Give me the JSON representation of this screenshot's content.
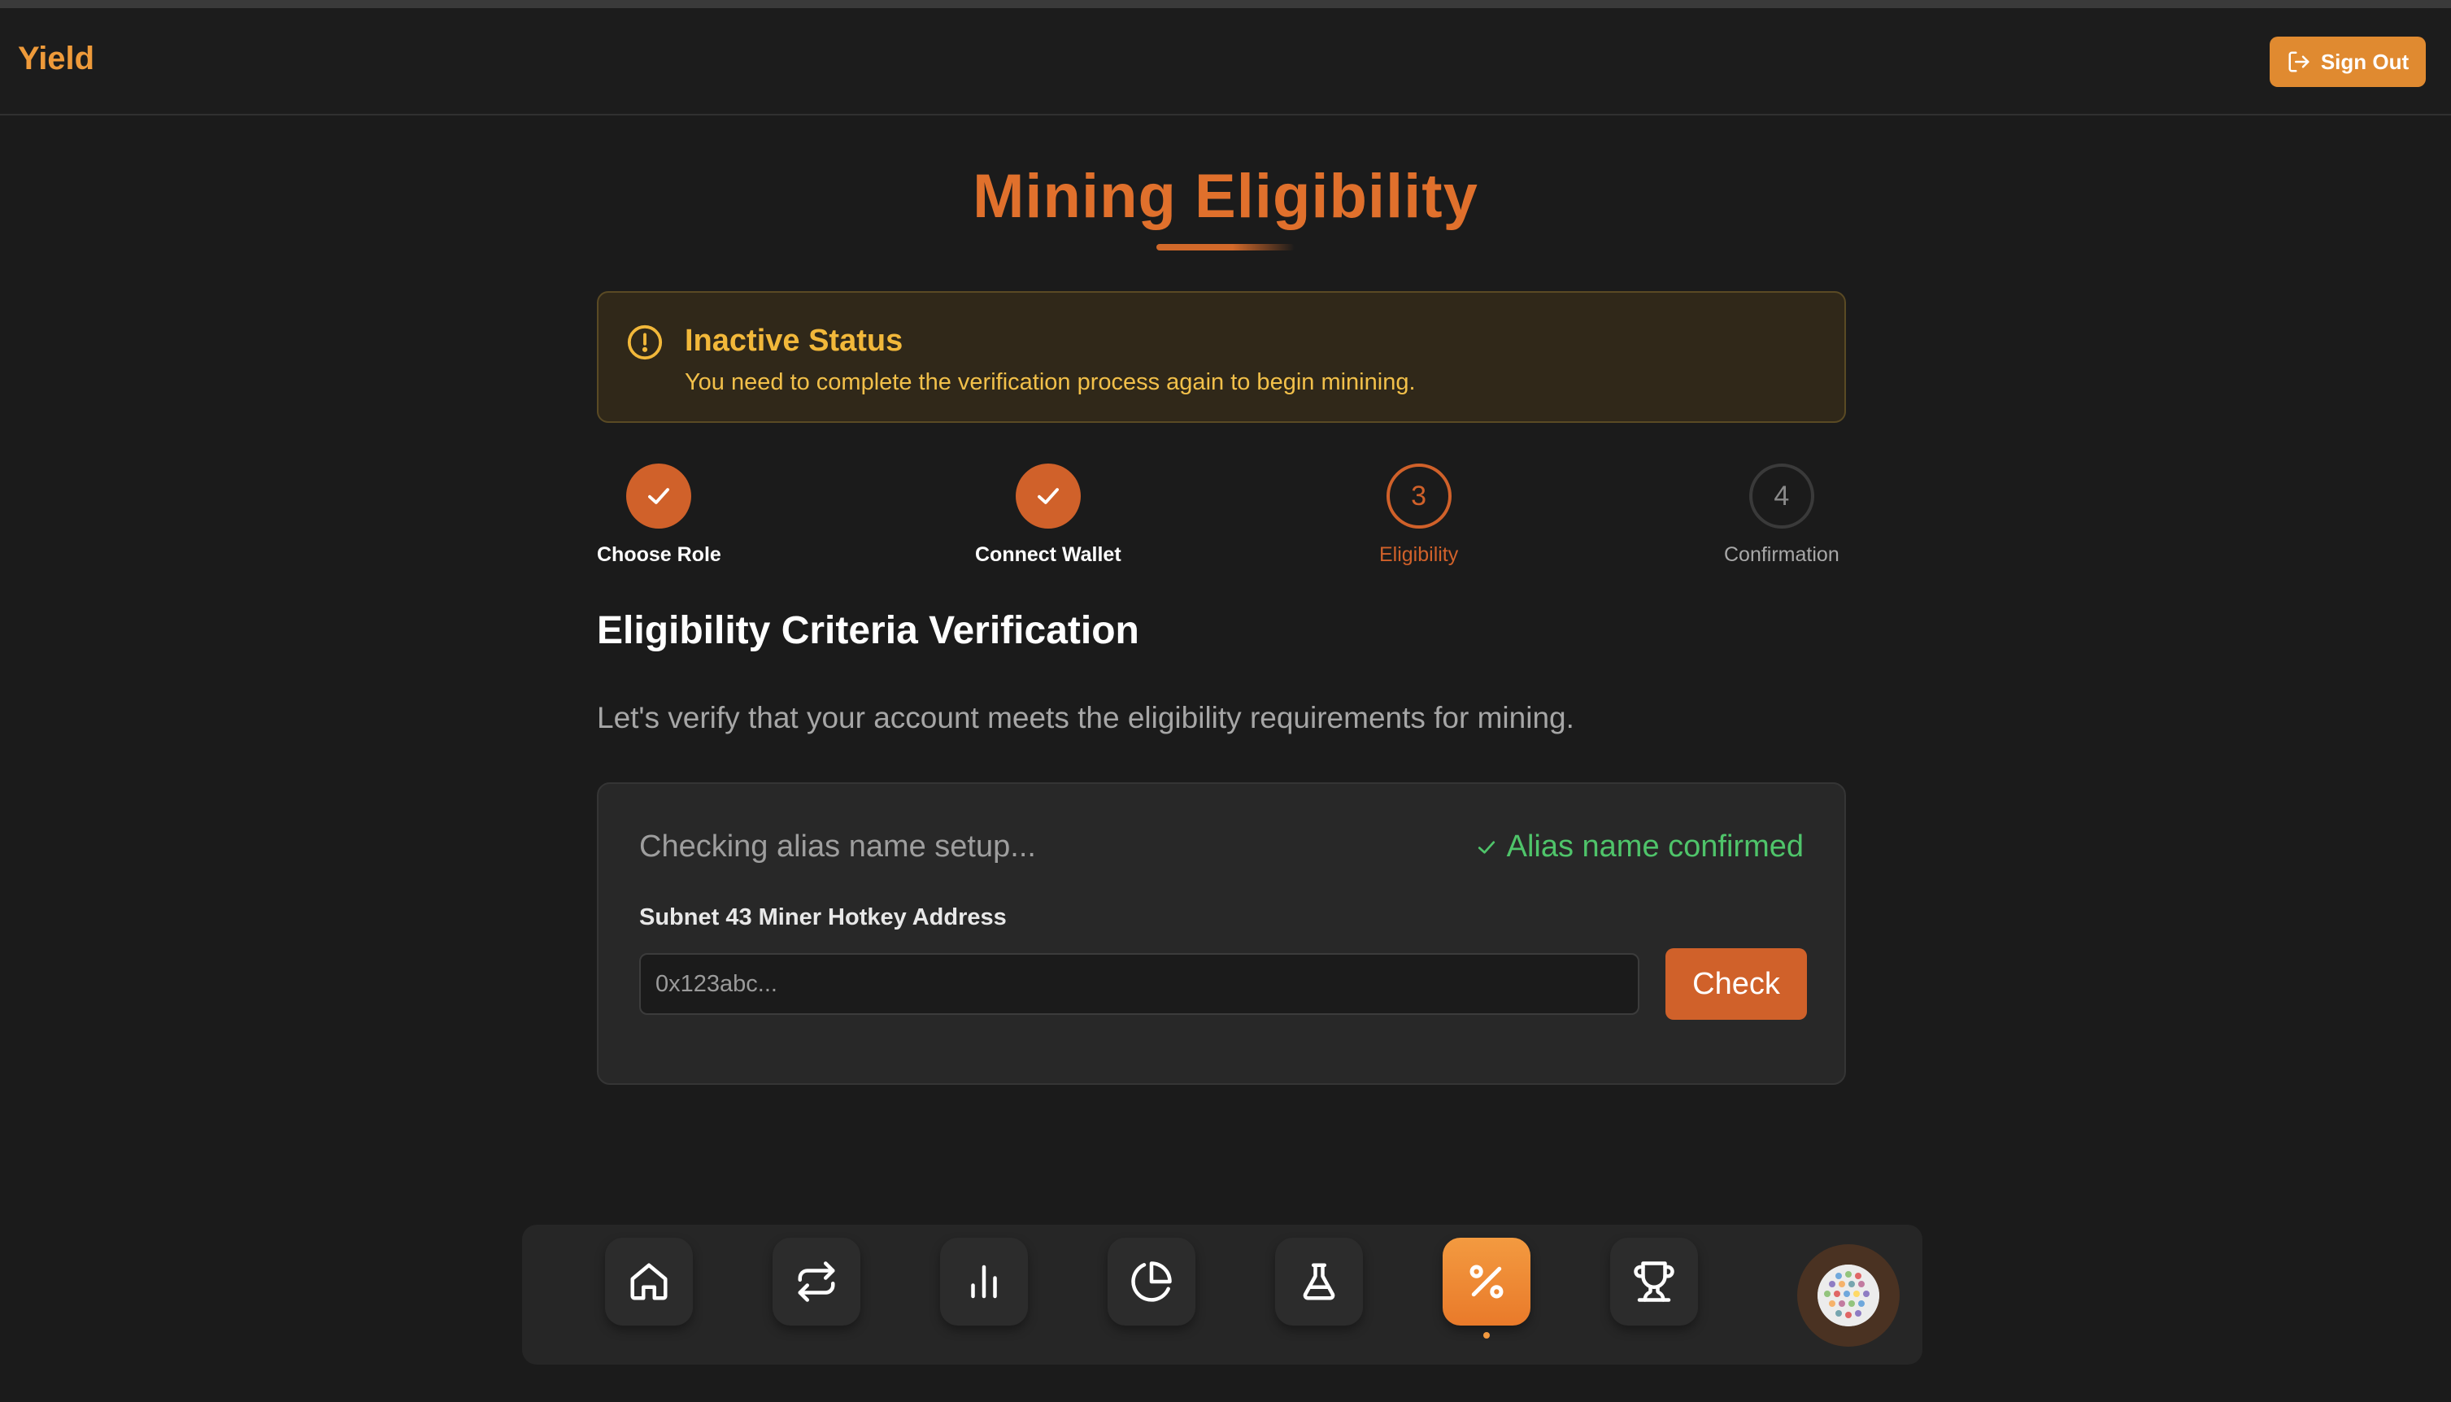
{
  "header": {
    "brand": "Yield",
    "sign_out_label": "Sign Out"
  },
  "page": {
    "title": "Mining Eligibility"
  },
  "alert": {
    "title": "Inactive Status",
    "message": "You need to complete the verification process again to begin minining."
  },
  "steps": [
    {
      "label": "Choose Role",
      "state": "done",
      "number": "1"
    },
    {
      "label": "Connect Wallet",
      "state": "done",
      "number": "2"
    },
    {
      "label": "Eligibility",
      "state": "active",
      "number": "3"
    },
    {
      "label": "Confirmation",
      "state": "pending",
      "number": "4"
    }
  ],
  "section": {
    "title": "Eligibility Criteria Verification",
    "description": "Let's verify that your account meets the eligibility requirements for mining."
  },
  "card": {
    "checking_text": "Checking alias name setup...",
    "confirmed_text": "Alias name confirmed",
    "field_label": "Subnet 43 Miner Hotkey Address",
    "input_placeholder": "0x123abc...",
    "input_value": "",
    "check_button": "Check"
  },
  "dock": {
    "items": [
      "home-icon",
      "swap-icon",
      "bar-chart-icon",
      "pie-chart-icon",
      "flask-icon",
      "percent-icon",
      "trophy-icon"
    ],
    "active": "percent-icon"
  },
  "colors": {
    "accent": "#d0612a",
    "brand": "#ee9a3a",
    "warning": "#f2b83a",
    "success": "#4fc46a",
    "background": "#1b1b1b"
  }
}
